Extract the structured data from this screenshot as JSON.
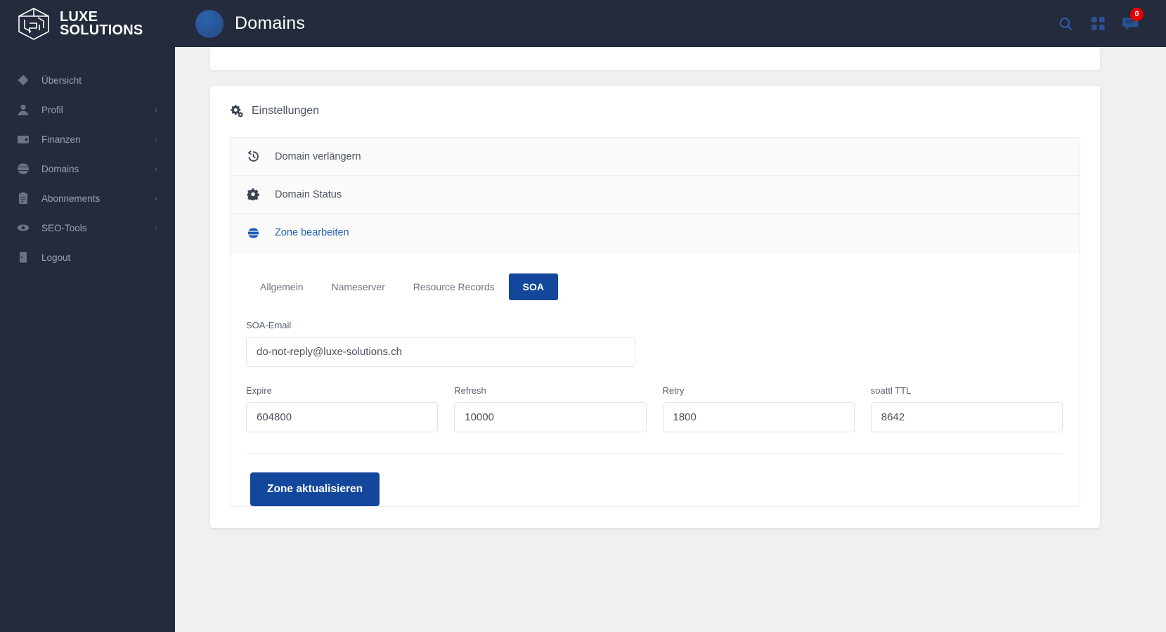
{
  "brand": {
    "line1": "LUXE",
    "line2": "SOLUTIONS",
    "logo_icon": "cube-logo-icon"
  },
  "topbar": {
    "menu_icon": "hamburger-menu-icon",
    "page_icon": "globe-circle-icon",
    "title": "Domains",
    "search_icon": "search-icon",
    "apps_icon": "grid-apps-icon",
    "messages_icon": "chat-bubble-icon",
    "badge_count": "0",
    "accent": "#2f62b5",
    "badge_color": "#e60000"
  },
  "sidebar": {
    "background": "#242b3d",
    "items": [
      {
        "label": "Übersicht",
        "icon": "diamond-icon",
        "caret": false,
        "caret_glyph": ""
      },
      {
        "label": "Profil",
        "icon": "user-icon",
        "caret": true,
        "caret_glyph": "›"
      },
      {
        "label": "Finanzen",
        "icon": "wallet-icon",
        "caret": true,
        "caret_glyph": "›"
      },
      {
        "label": "Domains",
        "icon": "globe-icon",
        "caret": true,
        "caret_glyph": "›"
      },
      {
        "label": "Abonnements",
        "icon": "clipboard-icon",
        "caret": true,
        "caret_glyph": "›"
      },
      {
        "label": "SEO-Tools",
        "icon": "eye-icon",
        "caret": true,
        "caret_glyph": "›"
      },
      {
        "label": "Logout",
        "icon": "logout-door-icon",
        "caret": false,
        "caret_glyph": ""
      }
    ]
  },
  "main": {
    "settings_card": {
      "icon": "cogs-icon",
      "title": "Einstellungen",
      "list": [
        {
          "label": "Domain verlängern",
          "icon": "history-clock-icon",
          "link": false
        },
        {
          "label": "Domain Status",
          "icon": "gear-icon",
          "link": false
        },
        {
          "label": "Zone bearbeiten",
          "icon": "globe-icon",
          "link": true
        }
      ],
      "tabs": [
        {
          "label": "Allgemein",
          "active": false
        },
        {
          "label": "Nameserver",
          "active": false
        },
        {
          "label": "Resource Records",
          "active": false
        },
        {
          "label": "SOA",
          "active": true
        }
      ],
      "form": {
        "email_label": "SOA-Email",
        "email_value": "do-not-reply@luxe-solutions.ch",
        "email_placeholder": "SOA-Email",
        "fields": [
          {
            "label": "Expire",
            "value": "604800",
            "placeholder": "Expire"
          },
          {
            "label": "Refresh",
            "value": "10000",
            "placeholder": "Refresh"
          },
          {
            "label": "Retry",
            "value": "1800",
            "placeholder": "Retry"
          },
          {
            "label": "soattl TTL",
            "value": "8642",
            "placeholder": "soattl TTL"
          }
        ],
        "submit_label": "Zone aktualisieren",
        "submit_color": "#13479c"
      }
    }
  }
}
